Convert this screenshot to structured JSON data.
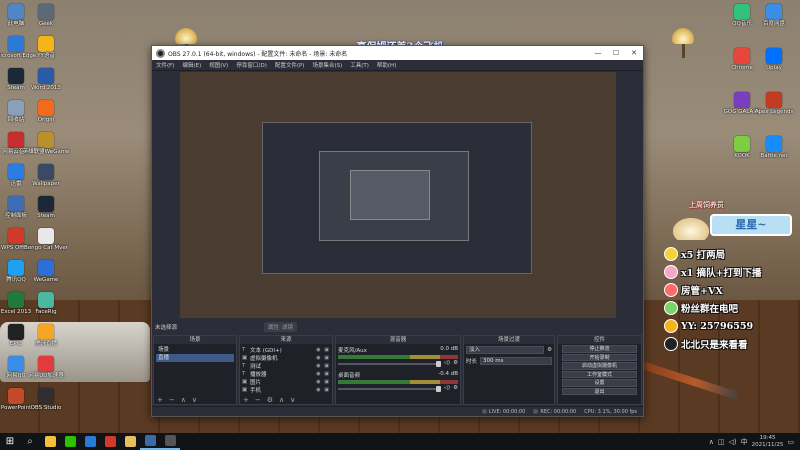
{
  "desktop_icons_left": [
    {
      "label": "此电脑",
      "color": "#4f86c6"
    },
    {
      "label": "Microsoft Edge",
      "color": "#2b7bd6"
    },
    {
      "label": "Steam",
      "color": "#1b2838"
    },
    {
      "label": "回收站",
      "color": "#8aa0b8"
    },
    {
      "label": "网易云音乐",
      "color": "#c62f2f"
    },
    {
      "label": "迅雷",
      "color": "#2a7de1"
    },
    {
      "label": "控制面板",
      "color": "#3d6eb4"
    },
    {
      "label": "WPS Office",
      "color": "#d03a2a"
    },
    {
      "label": "腾讯QQ",
      "color": "#1da1f2"
    },
    {
      "label": "Excel 2013",
      "color": "#1f7a3e"
    },
    {
      "label": "EPIC",
      "color": "#222"
    },
    {
      "label": "网易UU",
      "color": "#3a8ee6"
    },
    {
      "label": "PowerPoint",
      "color": "#c4482a"
    },
    {
      "label": "Geek",
      "color": "#5a6a78"
    },
    {
      "label": "YY语音",
      "color": "#f3b51a"
    },
    {
      "label": "Word 2013",
      "color": "#2b5aa8"
    },
    {
      "label": "Origin",
      "color": "#f26a1b"
    },
    {
      "label": "英雄联盟WeGame",
      "color": "#b8902e"
    },
    {
      "label": "Wallpaper",
      "color": "#3a4a66"
    },
    {
      "label": "Steam",
      "color": "#1b2838"
    },
    {
      "label": "Bongo Cat Mver",
      "color": "#e8e8e8"
    },
    {
      "label": "WeGame",
      "color": "#2d6fd6"
    },
    {
      "label": "FaceRig",
      "color": "#4bb8a0"
    },
    {
      "label": "虎牙直播",
      "color": "#f5a623"
    },
    {
      "label": "网易UU加速器",
      "color": "#e23c3c"
    },
    {
      "label": "OBS Studio",
      "color": "#302e31"
    }
  ],
  "desktop_icons_right": [
    {
      "label": "QQ音乐",
      "color": "#31c27c"
    },
    {
      "label": "百度网盘",
      "color": "#3a8ee6"
    },
    {
      "label": "Chrome",
      "color": "#e8453c"
    },
    {
      "label": "Uplay",
      "color": "#0070ff"
    },
    {
      "label": "GOG GALAXY",
      "color": "#7a3fbf"
    },
    {
      "label": "Apex Legends",
      "color": "#c23b22"
    },
    {
      "label": "KOOK",
      "color": "#7ccd42"
    },
    {
      "label": "Battle.net",
      "color": "#148eff"
    }
  ],
  "stream_title": "高保姆还差3个飞机",
  "obs": {
    "title": "OBS 27.0.1 (64-bit, windows) - 配置文件: 未命名 - 场景: 未命名",
    "menu": [
      "文件(F)",
      "编辑(E)",
      "视图(V)",
      "停靠窗口(D)",
      "配置文件(P)",
      "场景集合(S)",
      "工具(T)",
      "帮助(H)"
    ],
    "scene_bar": {
      "label": "未选择源",
      "props": "属性",
      "filters": "滤镜"
    },
    "docks": {
      "scenes": {
        "header": "场景",
        "items": [
          "场景",
          "直播"
        ],
        "selected_index": 1
      },
      "sources": {
        "header": "来源",
        "items": [
          {
            "icon": "T",
            "name": "文本 (GDI+)"
          },
          {
            "icon": "▣",
            "name": "虚拟摄像机"
          },
          {
            "icon": "T",
            "name": "测试"
          },
          {
            "icon": "T",
            "name": "播放器"
          },
          {
            "icon": "▣",
            "name": "图片"
          },
          {
            "icon": "▣",
            "name": "手机"
          }
        ]
      },
      "mixer": {
        "header": "混音器",
        "channels": [
          {
            "name": "麦克风/Aux",
            "db": "0.0 dB"
          },
          {
            "name": "桌面音频",
            "db": "-0.4 dB"
          }
        ]
      },
      "transitions": {
        "header": "场景过渡",
        "type": "淡入",
        "duration_label": "时长",
        "duration": "300 ms"
      },
      "controls": {
        "header": "控件",
        "buttons": [
          "停止推流",
          "开始录制",
          "启动虚拟摄像机",
          "工作室模式",
          "设置",
          "退出"
        ]
      }
    },
    "status": {
      "live": "LIVE: 00:00:00",
      "rec": "REC: 00:00:00",
      "cpu": "CPU: 3.1%, 30.00 fps"
    }
  },
  "overlay": {
    "header": "上周饲养员",
    "badge": "星星~",
    "lines": [
      {
        "text": "x5 打两局",
        "color": "#f4d23a"
      },
      {
        "text": "x1 摘队+打到下播",
        "color": "#f4a8c8"
      },
      {
        "text": "房管+VX",
        "color": "#ff6a6a"
      },
      {
        "text": "粉丝群在电吧",
        "color": "#7bd46a"
      },
      {
        "text": "YY: 25796559",
        "color": "#f3b51a"
      },
      {
        "text": "北北只是来看看",
        "color": "#222"
      }
    ]
  },
  "taskbar": {
    "apps": [
      {
        "name": "file-explorer",
        "color": "#f3c13a"
      },
      {
        "name": "wechat",
        "color": "#2dc100"
      },
      {
        "name": "edge",
        "color": "#2b7bd6"
      },
      {
        "name": "wps",
        "color": "#d03a2a"
      },
      {
        "name": "bongo",
        "color": "#e8c060"
      },
      {
        "name": "steam",
        "color": "#3a6aa8"
      },
      {
        "name": "obs",
        "color": "#555"
      }
    ],
    "time": "19:45",
    "date": "2021/11/25"
  }
}
